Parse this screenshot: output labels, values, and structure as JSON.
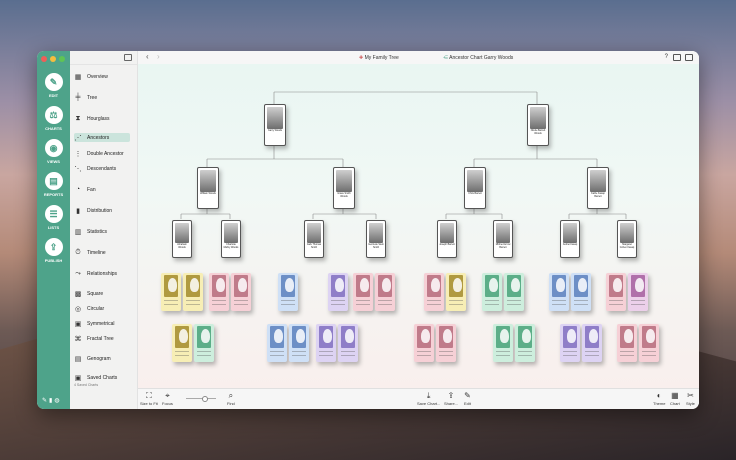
{
  "window": {
    "breadcrumb_tree": "My Family Tree",
    "breadcrumb_chart": "Ancestor Chart Garry Woods"
  },
  "rail": {
    "edit": "EDIT",
    "charts": "CHARTS",
    "views": "VIEWS",
    "reports": "REPORTS",
    "lists": "LISTS",
    "publish": "PUBLISH"
  },
  "sidebar": {
    "items": [
      {
        "label": "Overview",
        "icon": "overview-icon"
      },
      {
        "label": "Tree",
        "icon": "tree-icon"
      },
      {
        "label": "Hourglass",
        "icon": "hourglass-icon"
      },
      {
        "label": "Ancestors",
        "icon": "ancestors-icon"
      },
      {
        "label": "Double Ancestor",
        "icon": "double-ancestor-icon"
      },
      {
        "label": "Descendants",
        "icon": "descendants-icon"
      },
      {
        "label": "Fan",
        "icon": "fan-icon"
      },
      {
        "label": "Distribution",
        "icon": "distribution-icon"
      },
      {
        "label": "Statistics",
        "icon": "statistics-icon"
      },
      {
        "label": "Timeline",
        "icon": "timeline-icon"
      },
      {
        "label": "Relationships",
        "icon": "relationships-icon"
      },
      {
        "label": "Square",
        "icon": "square-icon"
      },
      {
        "label": "Circular",
        "icon": "circular-icon"
      },
      {
        "label": "Symmetrical",
        "icon": "symmetrical-icon"
      },
      {
        "label": "Fractal Tree",
        "icon": "fractal-tree-icon"
      },
      {
        "label": "Genogram",
        "icon": "genogram-icon"
      },
      {
        "label": "Saved Charts",
        "icon": "saved-charts-icon"
      }
    ],
    "saved_sub": "4 Saved Charts",
    "selected": "Ancestors"
  },
  "toolbar": {
    "size_to_fit": "Size to Fit",
    "focus": "Focus",
    "find": "Find",
    "save_chart": "Save Chart...",
    "share": "Share...",
    "edit": "Edit",
    "theme": "Theme",
    "chart": "Chart",
    "style": "Style"
  },
  "people": [
    {
      "name": "Garry Woods"
    },
    {
      "name": "Nicole Barrett Woods"
    },
    {
      "name": "William Woods"
    },
    {
      "name": "Grace Smith Woods"
    },
    {
      "name": "Chris Barrett"
    },
    {
      "name": "Kathe Kasap Barrett"
    },
    {
      "name": "Abraham Woods"
    },
    {
      "name": "Charlotte Mabry Woods"
    },
    {
      "name": "Jack Thomas Smith"
    },
    {
      "name": "Gertrude Stein Smith"
    },
    {
      "name": "Joseph Barrett"
    },
    {
      "name": "Mildred Arrow Barrett"
    },
    {
      "name": "Andrei Kasap"
    },
    {
      "name": "Margaret Cohen Kasap"
    }
  ],
  "colors": {
    "rail": "#4ea38a",
    "selected_nav": "#cbe4dc",
    "card_yellow": "#f7eeb5",
    "card_pink": "#f6d0d6",
    "card_blue": "#cfe0f6",
    "card_purple": "#ddd3f3",
    "card_green": "#cdeedd",
    "card_mauve": "#ecd0ea"
  }
}
